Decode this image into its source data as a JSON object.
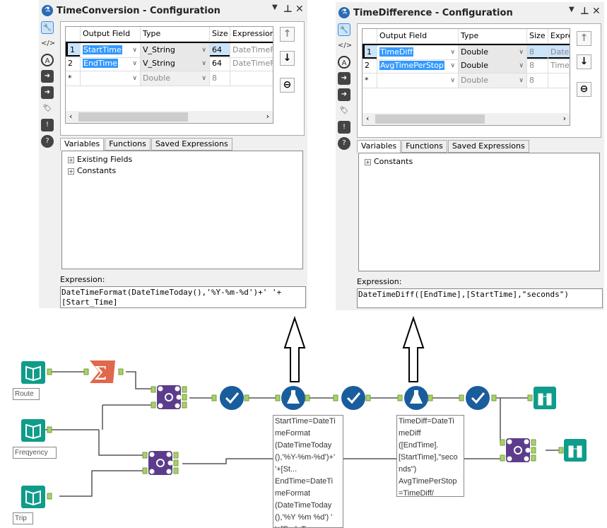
{
  "panels": [
    {
      "title": "TimeConversion - Configuration",
      "columns": [
        "Output Field",
        "Type",
        "Size",
        "Expression"
      ],
      "rows": [
        {
          "num": "1",
          "field": "StartTime",
          "type": "V_String",
          "size": "64",
          "expr": "DateTimeF"
        },
        {
          "num": "2",
          "field": "EndTime",
          "type": "V_String",
          "size": "64",
          "expr": "DateTimeF"
        },
        {
          "num": "*",
          "field": "",
          "type": "Double",
          "size": "8",
          "expr": ""
        }
      ],
      "tabs": [
        "Variables",
        "Functions",
        "Saved Expressions"
      ],
      "tree": [
        "Existing Fields",
        "Constants"
      ],
      "expression_label": "Expression:",
      "expression": "DateTimeFormat(DateTimeToday(),'%Y-%m-%d')+' '+\n[Start_Time]"
    },
    {
      "title": "TimeDifference - Configuration",
      "columns": [
        "Output Field",
        "Type",
        "Size",
        "Expre"
      ],
      "rows": [
        {
          "num": "1",
          "field": "TimeDiff",
          "type": "Double",
          "size": "8",
          "expr": "Date"
        },
        {
          "num": "2",
          "field": "AvgTimePerStop",
          "type": "Double",
          "size": "8",
          "expr": "Time"
        },
        {
          "num": "*",
          "field": "",
          "type": "Double",
          "size": "8",
          "expr": ""
        }
      ],
      "tabs": [
        "Variables",
        "Functions",
        "Saved Expressions"
      ],
      "tree": [
        "Constants"
      ],
      "expression_label": "Expression:",
      "expression": "DateTimeDiff([EndTime],[StartTime],\"seconds\")"
    }
  ],
  "workflow": {
    "inputs": [
      "Route",
      "Freqyency",
      "Trip"
    ],
    "annotations": [
      "StartTime=DateTi\nmeFormat\n(DateTimeToday\n(),'%Y-%m-%d')+'\n'+[St...\nEndTime=DateTi\nmeFormat\n(DateTimeToday\n(),'%Y %m %d') '\n'+[End_T...",
      "TimeDiff=DateTi\nmeDiff\n([EndTime].\n[StartTime],\"seco\nnds\")\nAvgTimePerStop\n=TimeDiff/\n[No_Stops]"
    ],
    "colors": {
      "input": "#0f9c8a",
      "summarize": "#e0684b",
      "join": "#5b3d8c",
      "select": "#1a5d9c",
      "browse": "#0f9c8a",
      "anchor": "#a6d26a"
    }
  }
}
